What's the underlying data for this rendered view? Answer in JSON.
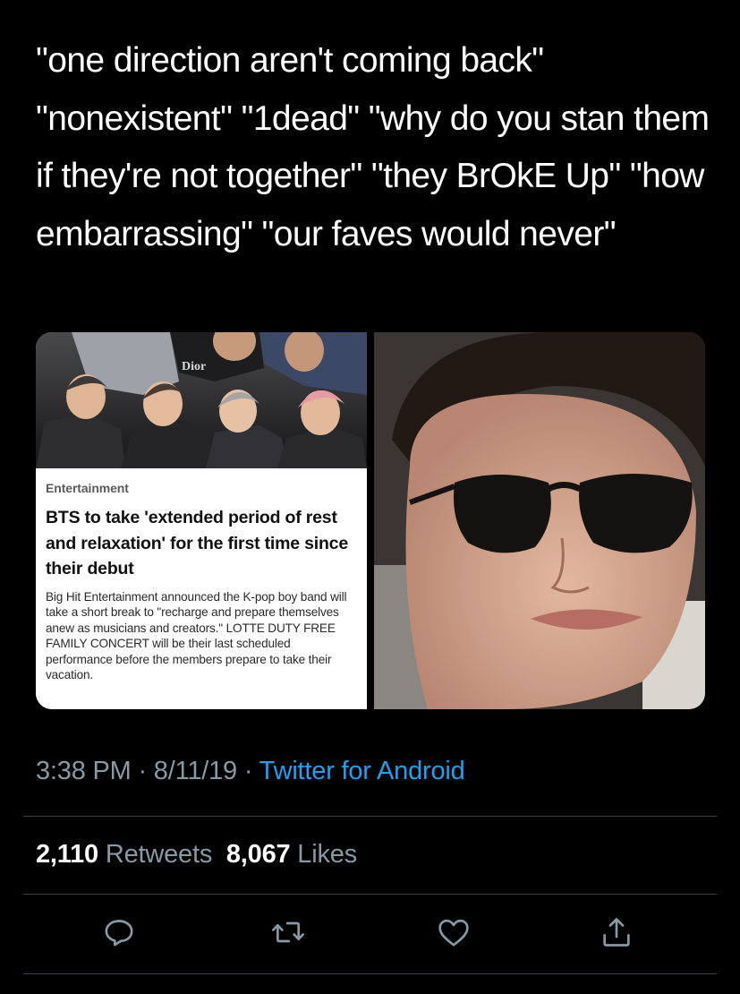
{
  "tweet": {
    "text": "\"one direction aren't coming back\" \"nonexistent\" \"1dead\" \"why do you stan them if they're not together\" \"they BrOkE Up\" \"how embarrassing\" \"our faves would never\"",
    "time": "3:38 PM",
    "date": "8/11/19",
    "separator": " · ",
    "source": "Twitter for Android",
    "retweets_count": "2,110",
    "retweets_label": "Retweets",
    "likes_count": "8,067",
    "likes_label": "Likes"
  },
  "article_card": {
    "category": "Entertainment",
    "headline": "BTS to take 'extended period of rest and relaxation' for the first time since their debut",
    "summary": "Big Hit Entertainment announced the K-pop boy band will take a short break to \"recharge and prepare themselves anew as musicians and creators.\" LOTTE DUTY FREE FAMILY CONCERT will be their last scheduled performance before the members prepare to take their vacation.",
    "photo_logo_text": "Dior"
  },
  "actions": {
    "reply_icon": "reply-icon",
    "retweet_icon": "retweet-icon",
    "like_icon": "heart-icon",
    "share_icon": "share-icon"
  },
  "colors": {
    "background": "#000000",
    "text": "#ffffff",
    "secondary_text": "#8899a6",
    "link": "#1da1f2",
    "divider": "#38444d"
  }
}
